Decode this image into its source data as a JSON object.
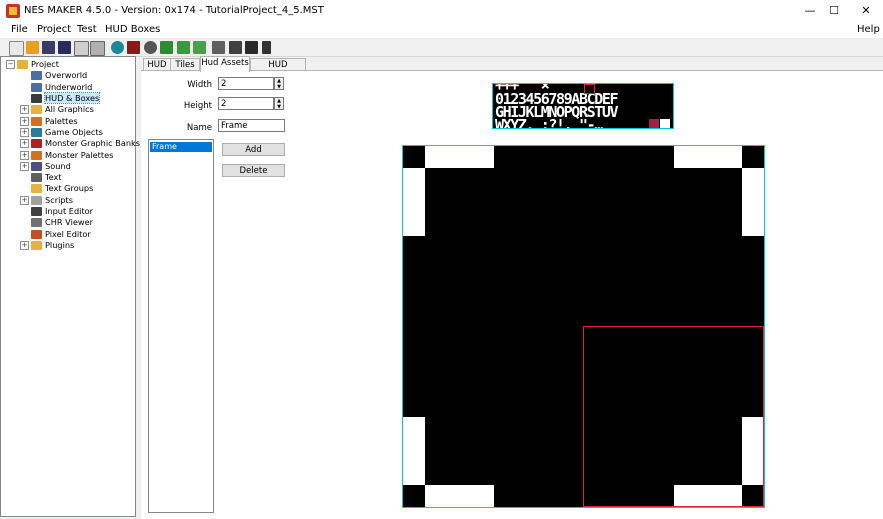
{
  "window": {
    "title": "NES MAKER 4.5.0 - Version: 0x174 - TutorialProject_4_5.MST",
    "minimize": "—",
    "maximize": "☐",
    "close": "✕"
  },
  "menu": {
    "items": [
      "File",
      "Project",
      "Test",
      "HUD Boxes"
    ],
    "help": "Help"
  },
  "toolbar": {
    "icons": [
      "new-project-icon",
      "open-icon",
      "save-icon",
      "save-as-icon",
      "import-icon",
      "export-icon",
      "globe-icon",
      "cartridge-icon",
      "settings-gear-icon",
      "green-tool-icon",
      "green-tool-2-icon",
      "green-tool-3-icon",
      "compile-icon",
      "screen-icon",
      "monitor-icon",
      "phone-icon"
    ]
  },
  "tree": {
    "root": "Project",
    "items": [
      {
        "label": "Overworld",
        "expandable": false,
        "selected": false,
        "icon": "map-icon"
      },
      {
        "label": "Underworld",
        "expandable": false,
        "selected": false,
        "icon": "map-icon"
      },
      {
        "label": "HUD & Boxes",
        "expandable": false,
        "selected": true,
        "icon": "hud-icon"
      },
      {
        "label": "All Graphics",
        "expandable": true,
        "selected": false,
        "icon": "folder-icon"
      },
      {
        "label": "Palettes",
        "expandable": true,
        "selected": false,
        "icon": "palette-icon"
      },
      {
        "label": "Game Objects",
        "expandable": true,
        "selected": false,
        "icon": "object-icon"
      },
      {
        "label": "Monster Graphic Banks",
        "expandable": true,
        "selected": false,
        "icon": "monster-icon"
      },
      {
        "label": "Monster Palettes",
        "expandable": true,
        "selected": false,
        "icon": "palette-icon"
      },
      {
        "label": "Sound",
        "expandable": true,
        "selected": false,
        "icon": "speaker-icon"
      },
      {
        "label": "Text",
        "expandable": false,
        "selected": false,
        "icon": "text-icon"
      },
      {
        "label": "Text Groups",
        "expandable": false,
        "selected": false,
        "icon": "folder-icon"
      },
      {
        "label": "Scripts",
        "expandable": true,
        "selected": false,
        "icon": "script-icon"
      },
      {
        "label": "Input Editor",
        "expandable": false,
        "selected": false,
        "icon": "controller-icon"
      },
      {
        "label": "CHR Viewer",
        "expandable": false,
        "selected": false,
        "icon": "grid-icon"
      },
      {
        "label": "Pixel Editor",
        "expandable": false,
        "selected": false,
        "icon": "pencil-icon"
      },
      {
        "label": "Plugins",
        "expandable": true,
        "selected": false,
        "icon": "folder-icon"
      }
    ]
  },
  "tabs": [
    "HUD",
    "Tiles",
    "Hud Assets",
    "HUD Elements"
  ],
  "active_tab": "Hud Assets",
  "form": {
    "width_label": "Width",
    "width_value": "2",
    "height_label": "Height",
    "height_value": "2",
    "name_label": "Name",
    "name_value": "Frame"
  },
  "assets_list": [
    "Frame"
  ],
  "buttons": {
    "add": "Add",
    "delete": "Delete"
  },
  "tileset": {
    "rows": [
      "+++  '   ×",
      "0123456789ABCDEF",
      "GHIJKLMNOPQRSTUV",
      "WXYZ. :?!, \"-…"
    ]
  },
  "colors": {
    "accent_selection": "#0078d7",
    "canvas_border": "#00c8d8",
    "selection_box": "#e0203c"
  }
}
